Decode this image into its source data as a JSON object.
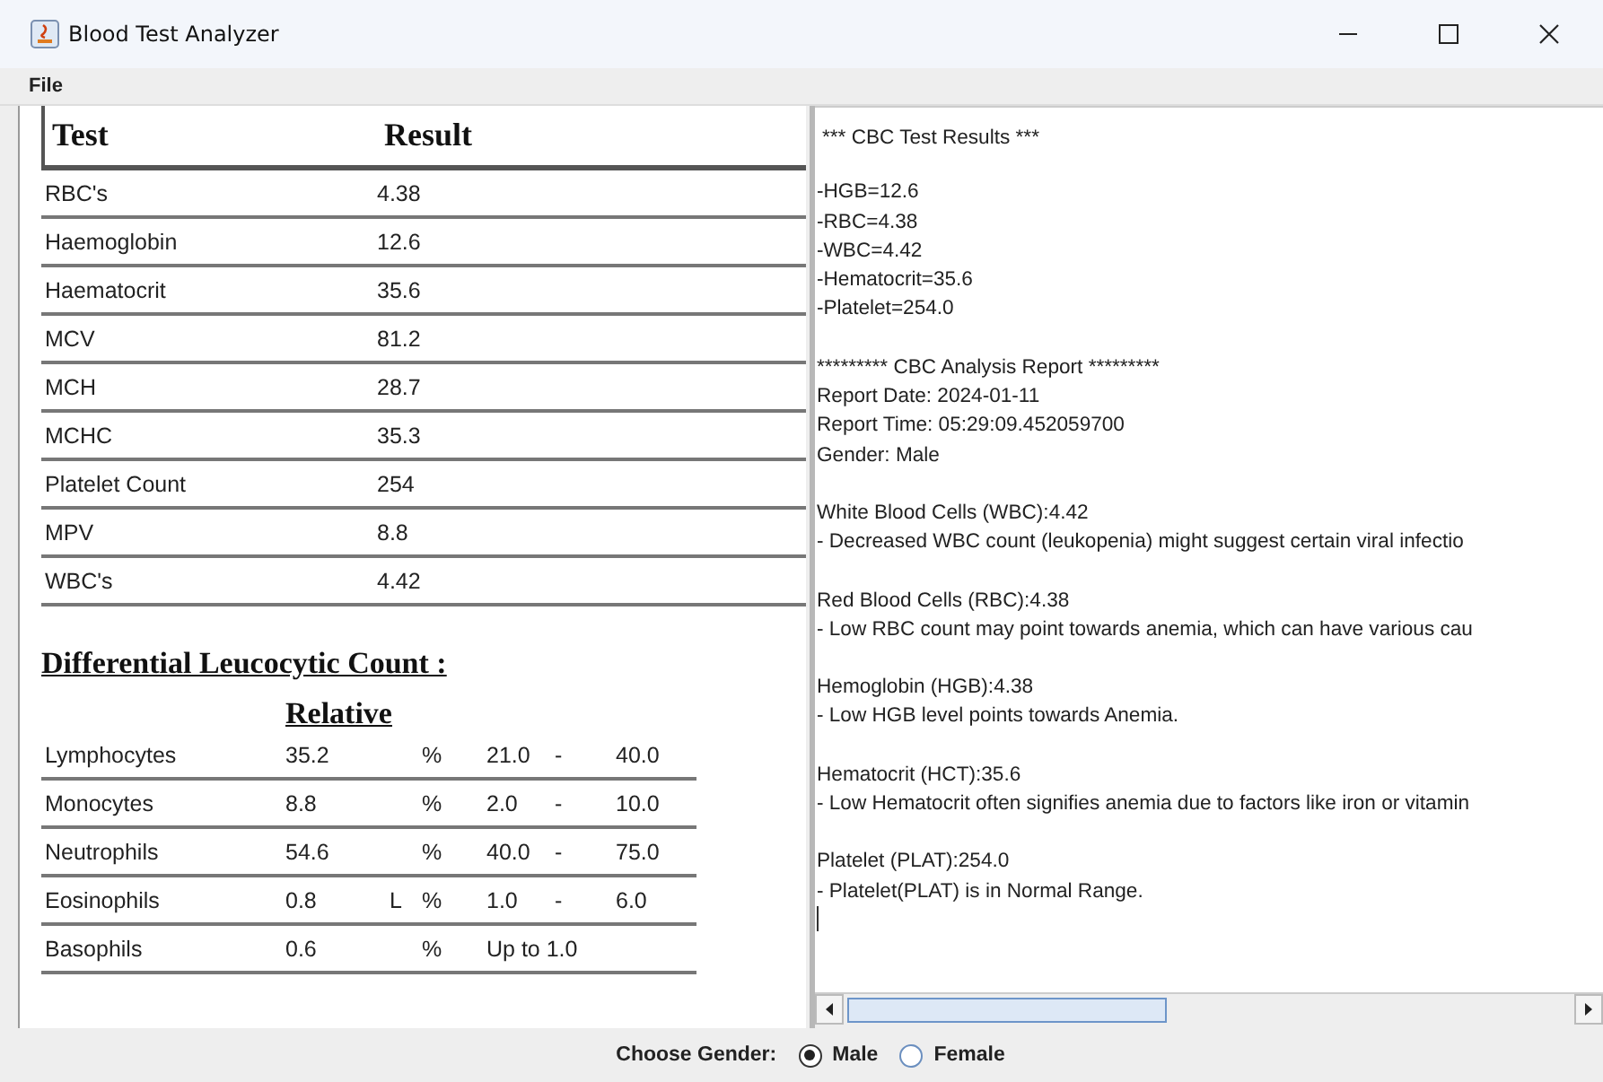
{
  "window": {
    "title": "Blood Test Analyzer"
  },
  "menu": [
    "File"
  ],
  "results_table": {
    "columns": [
      "Test",
      "Result"
    ],
    "rows": [
      {
        "test": "RBC's",
        "result": "4.38"
      },
      {
        "test": "Haemoglobin",
        "result": "12.6"
      },
      {
        "test": "Haematocrit",
        "result": "35.6"
      },
      {
        "test": "MCV",
        "result": "81.2"
      },
      {
        "test": "MCH",
        "result": "28.7"
      },
      {
        "test": "MCHC",
        "result": "35.3"
      },
      {
        "test": "Platelet Count",
        "result": "254"
      },
      {
        "test": "MPV",
        "result": "8.8"
      },
      {
        "test": "WBC's",
        "result": "4.42"
      }
    ]
  },
  "differential": {
    "title": "Differential Leucocytic Count :",
    "subheading": "Relative",
    "rows": [
      {
        "name": "Lymphocytes",
        "value": "35.2",
        "unit": "%",
        "low": "21.0",
        "separator": "-",
        "high": "40.0"
      },
      {
        "name": "Monocytes",
        "value": "8.8",
        "unit": "%",
        "low": "2.0",
        "separator": "-",
        "high": "10.0"
      },
      {
        "name": "Neutrophils",
        "value": "54.6",
        "unit": "%",
        "low": "40.0",
        "separator": "-",
        "high": "75.0"
      },
      {
        "name": "Eosinophils",
        "value": "0.8",
        "flag": "L",
        "unit": "%",
        "low": "1.0",
        "separator": "-",
        "high": "6.0"
      },
      {
        "name": "Basophils",
        "value": "0.6",
        "unit": "%",
        "range": "Up to 1.0"
      }
    ]
  },
  "report": {
    "blocks": [
      [
        "*** CBC Test Results ***"
      ],
      [
        "-HGB=12.6",
        "-RBC=4.38",
        "-WBC=4.42",
        "-Hematocrit=35.6",
        "-Platelet=254.0"
      ],
      [
        "********* CBC Analysis Report *********",
        "Report Date: 2024-01-11",
        "Report Time: 05:29:09.452059700",
        "Gender: Male"
      ],
      [
        "White Blood Cells (WBC):4.42",
        "- Decreased WBC count (leukopenia) might suggest certain viral infectio"
      ],
      [
        "Red Blood Cells (RBC):4.38",
        "- Low RBC count may point towards anemia, which can have various cau"
      ],
      [
        "Hemoglobin (HGB):4.38",
        "- Low HGB level points towards Anemia."
      ],
      [
        "Hematocrit (HCT):35.6",
        "- Low Hematocrit often signifies anemia due to factors like iron or vitamin"
      ],
      [
        "Platelet (PLAT):254.0",
        "- Platelet(PLAT) is in Normal Range."
      ]
    ]
  },
  "gender": {
    "label": "Choose Gender:",
    "options": [
      {
        "label": "Male",
        "selected": true
      },
      {
        "label": "Female",
        "selected": false
      }
    ]
  }
}
